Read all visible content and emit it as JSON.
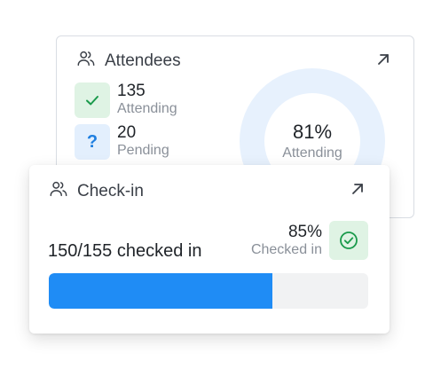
{
  "attendees_card": {
    "title": "Attendees",
    "icon": "users-icon",
    "expand_icon": "arrow-up-right-icon",
    "stats": [
      {
        "value": "135",
        "label": "Attending",
        "icon": "check-icon",
        "color": "#dff3e4",
        "icon_color": "#1a9a4b"
      },
      {
        "value": "20",
        "label": "Pending",
        "icon": "question-icon",
        "color": "#e3effd",
        "icon_color": "#1f7fe0"
      }
    ],
    "donut": {
      "percent": "81%",
      "label": "Attending",
      "fraction": 0.81,
      "color": "#e7f1fd"
    }
  },
  "checkin_card": {
    "title": "Check-in",
    "icon": "users-icon",
    "expand_icon": "arrow-up-right-icon",
    "checked_text": "150/155 checked in",
    "percent": "85%",
    "percent_label": "Checked in",
    "status_icon": "check-circle-icon",
    "progress": 0.7,
    "progress_color": "#1f8cf5",
    "status_color": "#1a9a4b"
  }
}
